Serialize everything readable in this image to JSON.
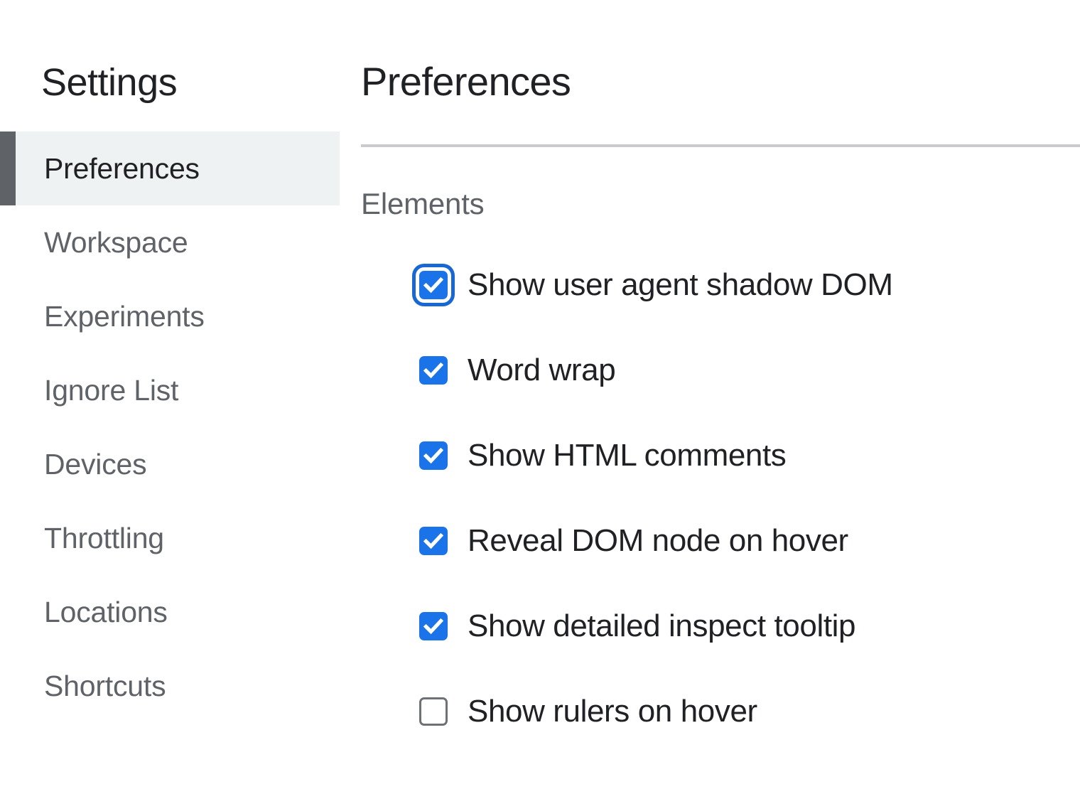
{
  "sidebar": {
    "title": "Settings",
    "items": [
      {
        "label": "Preferences",
        "selected": true
      },
      {
        "label": "Workspace",
        "selected": false
      },
      {
        "label": "Experiments",
        "selected": false
      },
      {
        "label": "Ignore List",
        "selected": false
      },
      {
        "label": "Devices",
        "selected": false
      },
      {
        "label": "Throttling",
        "selected": false
      },
      {
        "label": "Locations",
        "selected": false
      },
      {
        "label": "Shortcuts",
        "selected": false
      }
    ]
  },
  "panel": {
    "title": "Preferences",
    "section_heading": "Elements",
    "checkboxes": [
      {
        "label": "Show user agent shadow DOM",
        "checked": true,
        "focused": true
      },
      {
        "label": "Word wrap",
        "checked": true,
        "focused": false
      },
      {
        "label": "Show HTML comments",
        "checked": true,
        "focused": false
      },
      {
        "label": "Reveal DOM node on hover",
        "checked": true,
        "focused": false
      },
      {
        "label": "Show detailed inspect tooltip",
        "checked": true,
        "focused": false
      },
      {
        "label": "Show rulers on hover",
        "checked": false,
        "focused": false
      }
    ]
  },
  "colors": {
    "accent_blue": "#1a73e8",
    "focus_ring_blue": "#1967d2",
    "selected_row_bg": "#eff2f3",
    "selected_marker": "#5f6368",
    "text_primary": "#202124",
    "text_secondary": "#5f6368",
    "divider": "#c9cbcf",
    "unchecked_border": "#6e7276"
  }
}
